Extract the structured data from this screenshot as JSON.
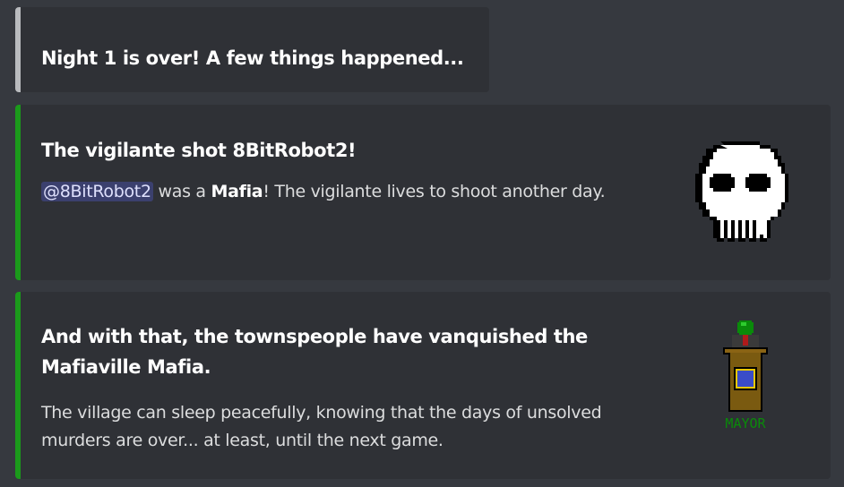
{
  "embeds": [
    {
      "title": "Night 1 is over! A few things happened...",
      "accent_color": "#b9bbbe"
    },
    {
      "title": "The vigilante shot 8BitRobot2!",
      "mention": "@8BitRobot2",
      "desc_part1": " was a ",
      "desc_bold": "Mafia",
      "desc_part2": "! The vigilante lives to shoot another day.",
      "accent_color": "#1b9a1b",
      "thumbnail_icon": "skull-icon"
    },
    {
      "title": "And with that, the townspeople have vanquished the Mafiaville Mafia.",
      "description": "The village can sleep peacefully, knowing that the days of unsolved murders are over... at least, until the next game.",
      "accent_color": "#1b9a1b",
      "thumbnail_icon": "mayor-icon",
      "thumbnail_label": "MAYOR"
    }
  ]
}
